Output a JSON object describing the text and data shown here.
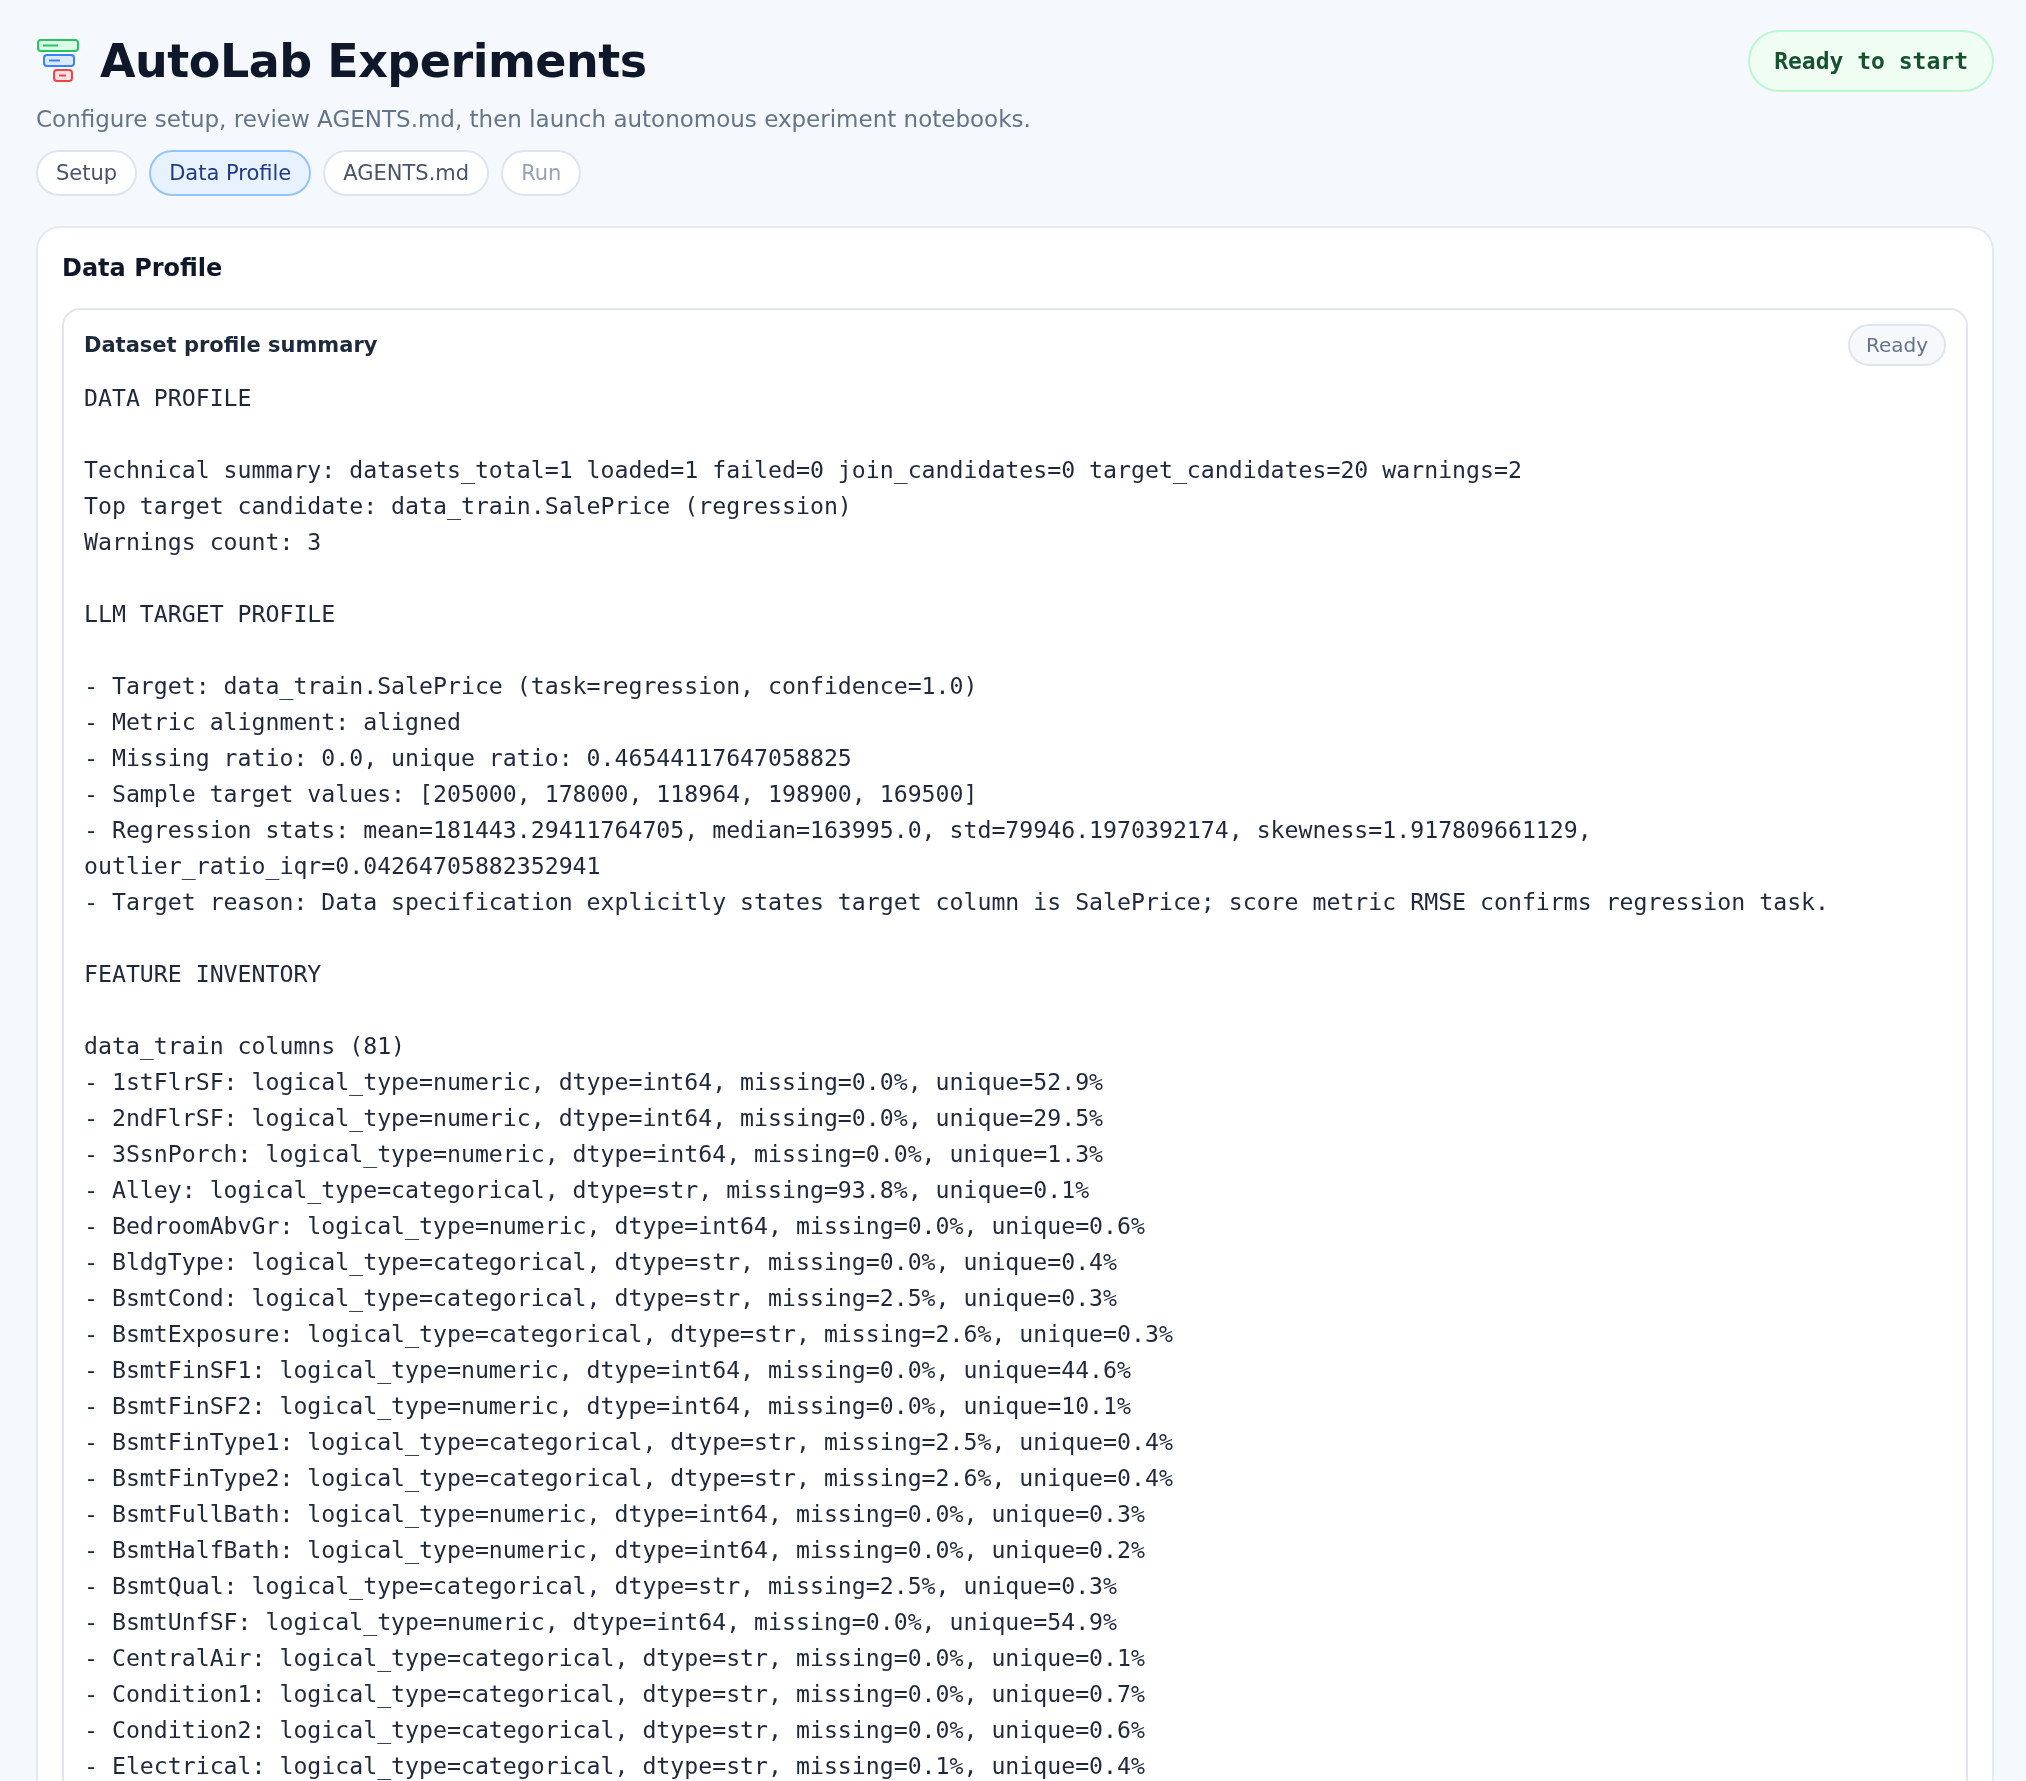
{
  "header": {
    "title": "AutoLab Experiments",
    "subtitle": "Configure setup, review AGENTS.md, then launch autonomous experiment notebooks.",
    "status": "Ready to start"
  },
  "tabs": [
    {
      "label": "Setup",
      "selected": false,
      "disabled": false
    },
    {
      "label": "Data Profile",
      "selected": true,
      "disabled": false
    },
    {
      "label": "AGENTS.md",
      "selected": false,
      "disabled": false
    },
    {
      "label": "Run",
      "selected": false,
      "disabled": true
    }
  ],
  "card": {
    "title": "Data Profile",
    "panel": {
      "title": "Dataset profile summary",
      "badge": "Ready",
      "sections": [
        {
          "title": "DATA PROFILE",
          "lines": [
            "Technical summary: datasets_total=1 loaded=1 failed=0 join_candidates=0 target_candidates=20 warnings=2",
            "Top target candidate: data_train.SalePrice (regression)",
            "Warnings count: 3"
          ]
        },
        {
          "title": "LLM TARGET PROFILE",
          "lines": [
            "- Target: data_train.SalePrice (task=regression, confidence=1.0)",
            "- Metric alignment: aligned",
            "- Missing ratio: 0.0, unique ratio: 0.46544117647058825",
            "- Sample target values: [205000, 178000, 118964, 198900, 169500]",
            "- Regression stats: mean=181443.29411764705, median=163995.0, std=79946.1970392174, skewness=1.917809661129, outlier_ratio_iqr=0.04264705882352941",
            "- Target reason: Data specification explicitly states target column is SalePrice; score metric RMSE confirms regression task."
          ]
        },
        {
          "title": "FEATURE INVENTORY",
          "lines": [
            "data_train columns (81)",
            "- 1stFlrSF: logical_type=numeric, dtype=int64, missing=0.0%, unique=52.9%",
            "- 2ndFlrSF: logical_type=numeric, dtype=int64, missing=0.0%, unique=29.5%",
            "- 3SsnPorch: logical_type=numeric, dtype=int64, missing=0.0%, unique=1.3%",
            "- Alley: logical_type=categorical, dtype=str, missing=93.8%, unique=0.1%",
            "- BedroomAbvGr: logical_type=numeric, dtype=int64, missing=0.0%, unique=0.6%",
            "- BldgType: logical_type=categorical, dtype=str, missing=0.0%, unique=0.4%",
            "- BsmtCond: logical_type=categorical, dtype=str, missing=2.5%, unique=0.3%",
            "- BsmtExposure: logical_type=categorical, dtype=str, missing=2.6%, unique=0.3%",
            "- BsmtFinSF1: logical_type=numeric, dtype=int64, missing=0.0%, unique=44.6%",
            "- BsmtFinSF2: logical_type=numeric, dtype=int64, missing=0.0%, unique=10.1%",
            "- BsmtFinType1: logical_type=categorical, dtype=str, missing=2.5%, unique=0.4%",
            "- BsmtFinType2: logical_type=categorical, dtype=str, missing=2.6%, unique=0.4%",
            "- BsmtFullBath: logical_type=numeric, dtype=int64, missing=0.0%, unique=0.3%",
            "- BsmtHalfBath: logical_type=numeric, dtype=int64, missing=0.0%, unique=0.2%",
            "- BsmtQual: logical_type=categorical, dtype=str, missing=2.5%, unique=0.3%",
            "- BsmtUnfSF: logical_type=numeric, dtype=int64, missing=0.0%, unique=54.9%",
            "- CentralAir: logical_type=categorical, dtype=str, missing=0.0%, unique=0.1%",
            "- Condition1: logical_type=categorical, dtype=str, missing=0.0%, unique=0.7%",
            "- Condition2: logical_type=categorical, dtype=str, missing=0.0%, unique=0.6%",
            "- Electrical: logical_type=categorical, dtype=str, missing=0.1%, unique=0.4%"
          ]
        }
      ]
    }
  }
}
